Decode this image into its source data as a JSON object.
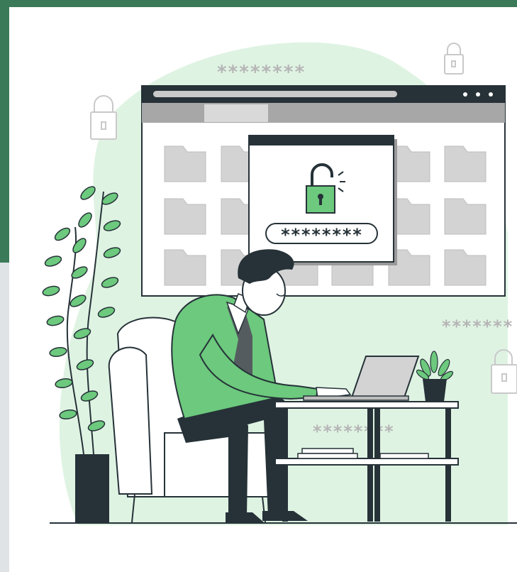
{
  "illustration": {
    "subject": "password-protected-files",
    "icons": [
      "padlock-icon",
      "open-padlock-icon",
      "folder-icon",
      "plant-icon",
      "laptop-icon",
      "armchair-icon"
    ],
    "colors": {
      "accent": "#6cc97d",
      "accent_light": "#dff3e3",
      "dark": "#263238",
      "folder": "#d3d3d3",
      "frame_bg": "#3b7a58",
      "asterisk_gray": "#b5b5b5"
    },
    "texts": {
      "password_field": "********",
      "top_asterisks": "********",
      "right_asterisks": "*******",
      "table_asterisks": "********"
    }
  }
}
